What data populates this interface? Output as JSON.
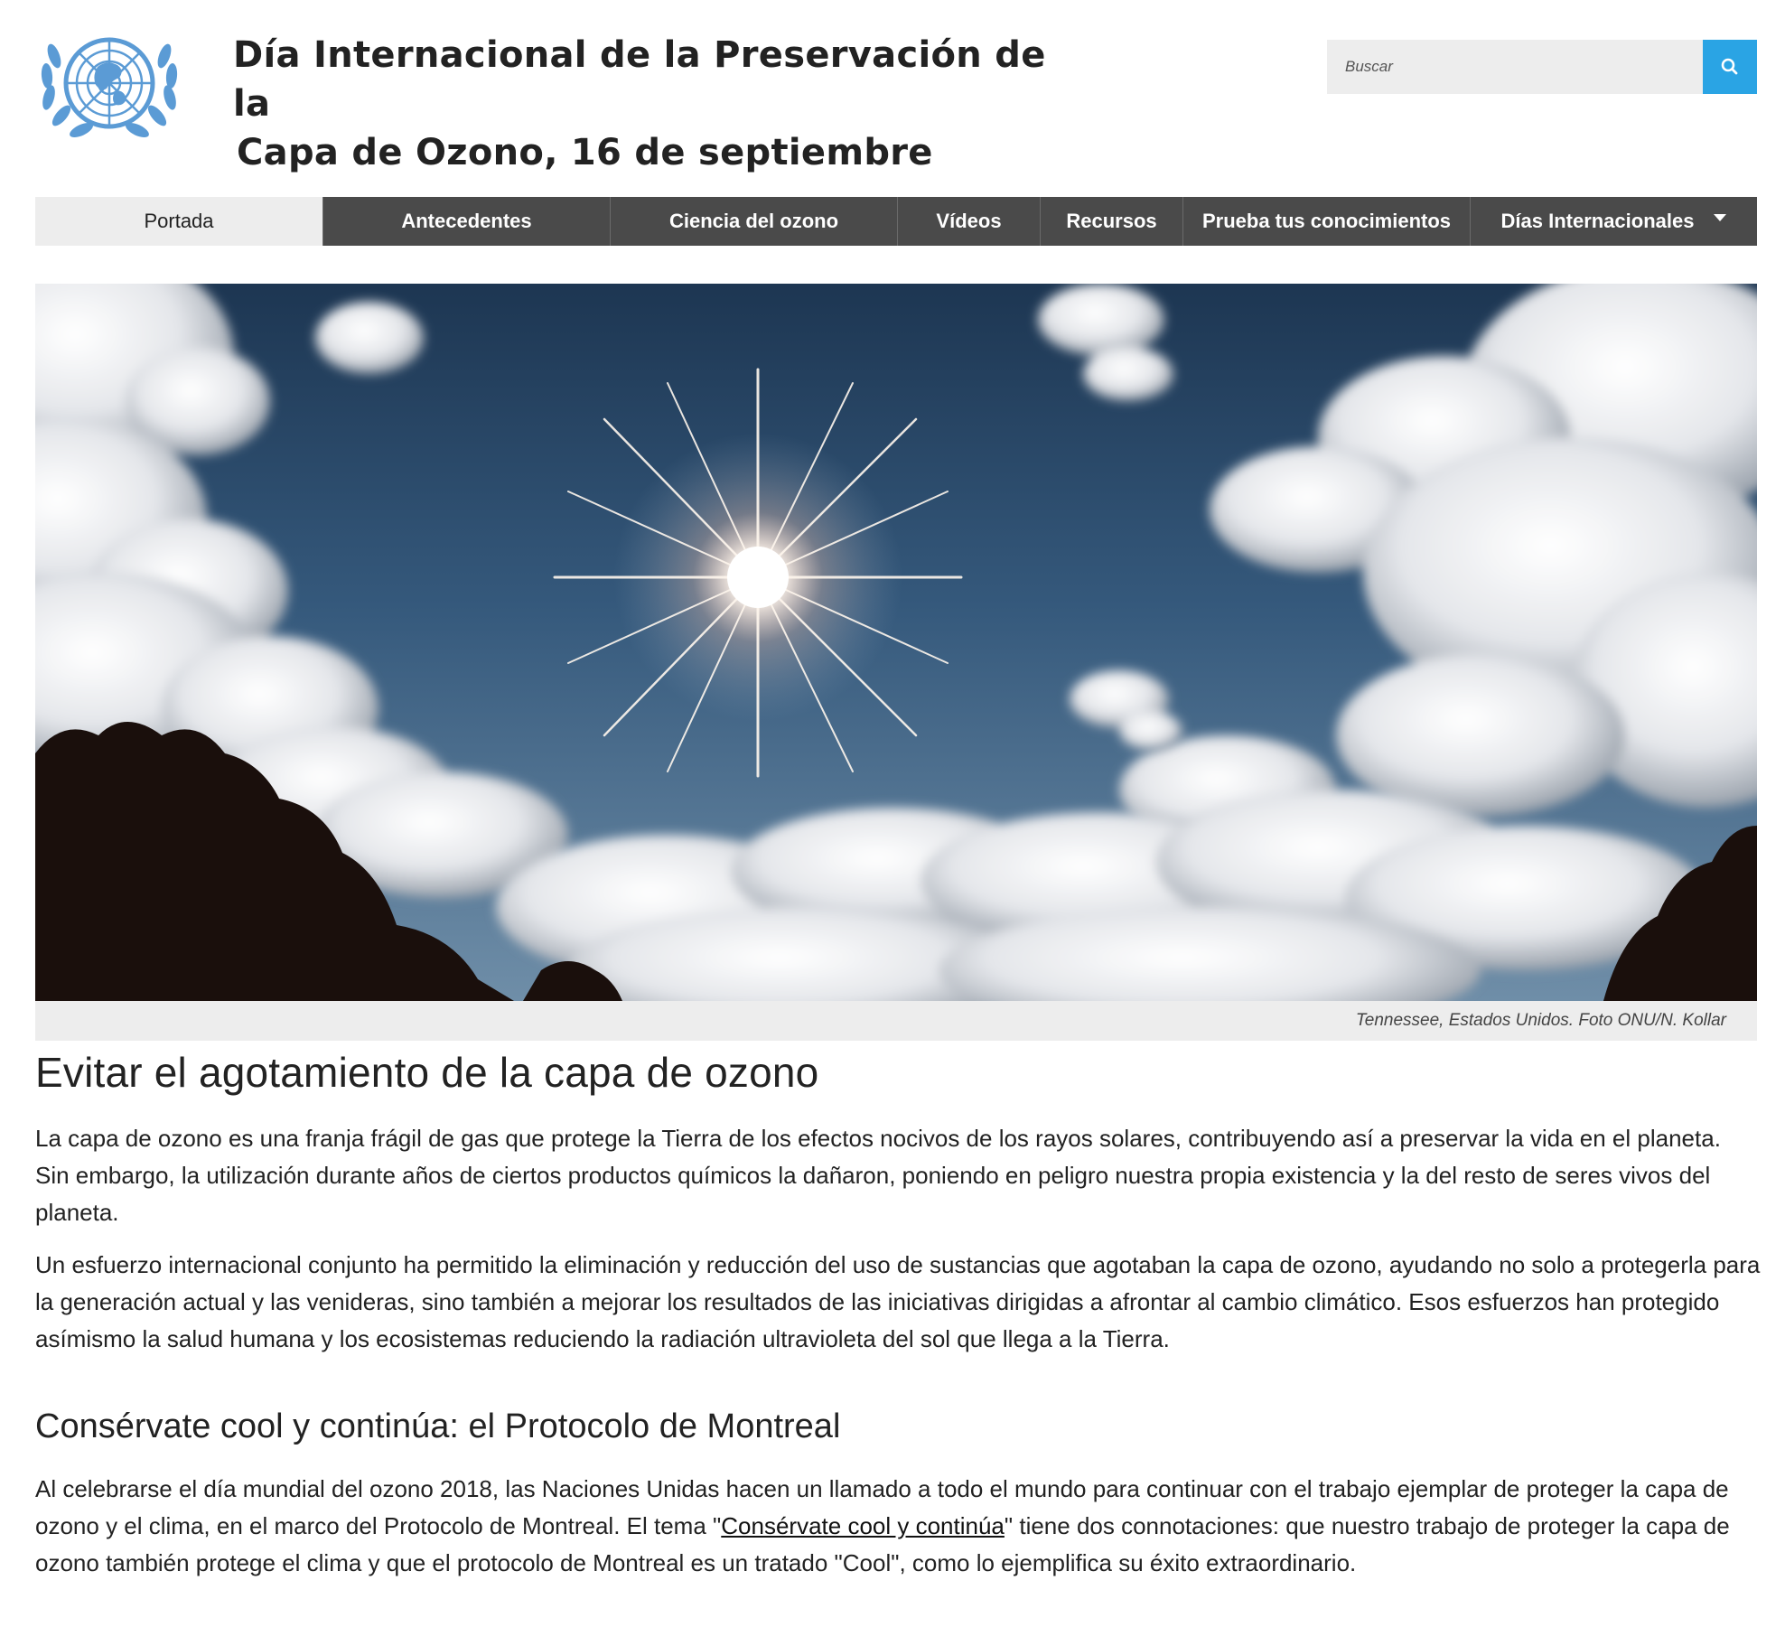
{
  "header": {
    "logo_alt": "Emblema de las Naciones Unidas",
    "title_line1": "Día Internacional de la Preservación de la",
    "title_line2": "Capa de Ozono, 16 de septiembre"
  },
  "search": {
    "placeholder": "Buscar",
    "button_icon": "search-icon"
  },
  "nav": {
    "items": [
      {
        "label": "Portada",
        "active": true
      },
      {
        "label": "Antecedentes"
      },
      {
        "label": "Ciencia del ozono"
      },
      {
        "label": "Vídeos"
      },
      {
        "label": "Recursos"
      },
      {
        "label": "Prueba tus conocimientos"
      },
      {
        "label": "Días Internacionales",
        "has_dropdown": true
      }
    ]
  },
  "hero": {
    "caption": "Tennessee, Estados Unidos. Foto ONU/N. Kollar"
  },
  "content": {
    "heading": "Evitar el agotamiento de la capa de ozono",
    "para1": "La capa de ozono es una franja frágil de gas que protege la Tierra de los efectos nocivos de los rayos solares, contribuyendo así a preservar la vida en el planeta. Sin embargo, la utilización durante años de ciertos productos químicos la dañaron, poniendo en peligro nuestra propia existencia y la del resto de seres vivos del planeta.",
    "para2": "Un esfuerzo internacional conjunto ha permitido la eliminación y reducción del uso de sustancias que agotaban la capa de ozono, ayudando no solo a protegerla para la generación actual y las venideras, sino también a mejorar los resultados de las iniciativas dirigidas a afrontar al cambio climático. Esos esfuerzos han protegido asímismo la salud humana y los ecosistemas reduciendo la radiación ultravioleta del sol que llega a la Tierra.",
    "subheading": "Consérvate cool y continúa: el Protocolo de Montreal",
    "para3_before": "Al celebrarse el día mundial del ozono 2018, las Naciones Unidas hacen un llamado a todo el mundo para continuar con el trabajo ejemplar de proteger la capa de ozono y el clima, en el marco del Protocolo de Montreal. El tema \"",
    "para3_link": "Consérvate cool y continúa",
    "para3_after": "\" tiene dos connotaciones: que nuestro trabajo de proteger la capa de ozono también protege el clima y que el protocolo de Montreal es un tratado \"Cool\", como lo ejemplifica su éxito extraordinario."
  },
  "colors": {
    "un_blue": "#5b9bd5",
    "nav_dark": "#4a4a4a",
    "nav_active_bg": "#ededed",
    "search_button": "#2aa4e4"
  }
}
